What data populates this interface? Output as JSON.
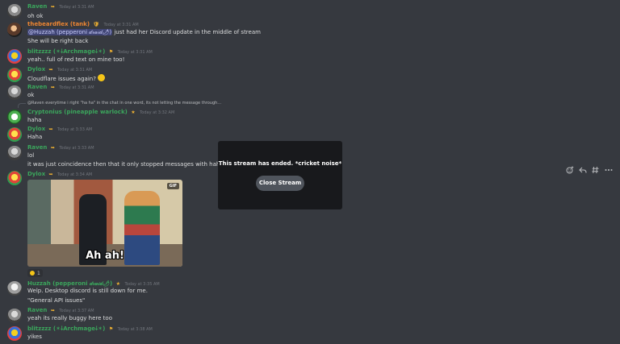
{
  "messages": [
    {
      "user": "Raven",
      "badge": "➥",
      "time": "Today at 3:31 AM",
      "color": "#3ba55c",
      "lines": [
        "oh ok"
      ]
    },
    {
      "user": "thebeardflex (tank)",
      "badge": "🛡",
      "time": "Today at 3:31 AM",
      "color": "#ec8532",
      "mention": "@Huzzah (pepperoni 𝒹𝓇𝓊𝒾𝒹🌶)",
      "text_after_mention": " just had her Discord update in the middle of stream",
      "lines": [
        "She will be right back"
      ]
    },
    {
      "user": "blitzzzz (✶⸸Archmage⸸✶)",
      "badge": "⚑",
      "time": "Today at 3:31 AM",
      "color": "#3ba55c",
      "lines": [
        "yeah.. full of red text on mine too!"
      ]
    },
    {
      "user": "Dylox",
      "badge": "➥",
      "time": "Today at 3:31 AM",
      "color": "#3ba55c",
      "lines": [
        "Cloudflare issues again?"
      ]
    },
    {
      "user": "Raven",
      "badge": "➥",
      "time": "Today at 3:31 AM",
      "color": "#3ba55c",
      "lines": [
        "ok"
      ]
    },
    {
      "reply": "@Raven everytime i right \"ha ha\" in the chat in one word, its not letting the message through...",
      "user": "Cryptonius (pineapple warlock)",
      "badge": "★",
      "time": "Today at 3:32 AM",
      "color": "#3ba55c",
      "lines": [
        "haha"
      ]
    },
    {
      "user": "Dylox",
      "badge": "➥",
      "time": "Today at 3:33 AM",
      "color": "#3ba55c",
      "lines": [
        "Haha"
      ]
    },
    {
      "user": "Raven",
      "badge": "➥",
      "time": "Today at 3:33 AM",
      "color": "#3ba55c",
      "lines": [
        "lol",
        "it was just coincidence then that it only stopped messages with haha"
      ]
    },
    {
      "user": "Dylox",
      "badge": "➥",
      "time": "Today at 3:34 AM",
      "color": "#3ba55c",
      "gif_caption": "Ah ah!",
      "gif_badge": "GIF",
      "reaction_count": "1"
    },
    {
      "user": "Huzzah (pepperoni 𝒹𝓇𝓊𝒾𝒹🌶)",
      "badge": "★",
      "time": "Today at 3:35 AM",
      "color": "#3ba55c",
      "lines": [
        "Welp. Desktop discord is still down for me.",
        "\"General API issues\""
      ]
    },
    {
      "user": "Raven",
      "badge": "➥",
      "time": "Today at 3:37 AM",
      "color": "#3ba55c",
      "lines": [
        "yeah its really buggy here too"
      ]
    },
    {
      "user": "blitzzzz (✶⸸Archmage⸸✶)",
      "badge": "⚑",
      "time": "Today at 3:38 AM",
      "color": "#3ba55c",
      "lines": [
        "yikes"
      ]
    }
  ],
  "overlay": {
    "title": "This stream has ended. *cricket noise*",
    "button": "Close Stream"
  },
  "actions": [
    "add-reaction-icon",
    "reply-icon",
    "create-thread-icon",
    "more-icon"
  ]
}
